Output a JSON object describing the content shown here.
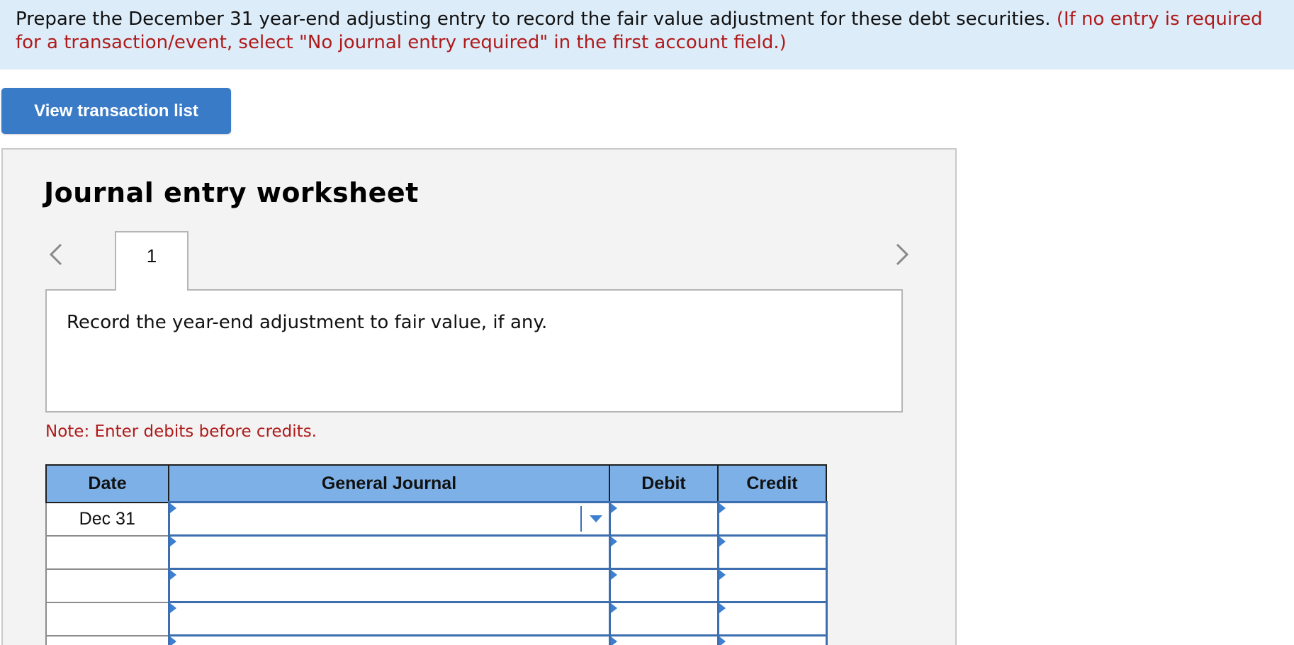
{
  "instruction": {
    "main": "Prepare the December 31 year-end adjusting entry to record the fair value adjustment for these debt securities.",
    "hint": "(If no entry is required for a transaction/event, select \"No journal entry required\" in the first account field.)",
    "hint_line1": "(If no entry is required",
    "hint_line2": "for a transaction/event, select \"No journal entry required\" in the first account field.)"
  },
  "buttons": {
    "view_transaction_list": "View transaction list"
  },
  "worksheet": {
    "title": "Journal entry worksheet",
    "tabs": [
      {
        "label": "1"
      }
    ],
    "description": "Record the year-end adjustment to fair value, if any.",
    "note": "Note: Enter debits before credits."
  },
  "journal_table": {
    "headers": {
      "date": "Date",
      "general_journal": "General Journal",
      "debit": "Debit",
      "credit": "Credit"
    },
    "rows": [
      {
        "date": "Dec 31"
      },
      {
        "date": ""
      },
      {
        "date": ""
      },
      {
        "date": ""
      },
      {
        "date": ""
      }
    ]
  },
  "colors": {
    "banner_bg": "#dcecf9",
    "button_bg": "#3a7bc8",
    "table_header_bg": "#7db0e6",
    "hint_red": "#b01a1a",
    "input_border_blue": "#3d6fb0"
  },
  "icons": {
    "prev": "chevron-left-icon",
    "next": "chevron-right-icon",
    "dropdown": "caret-down-icon"
  }
}
